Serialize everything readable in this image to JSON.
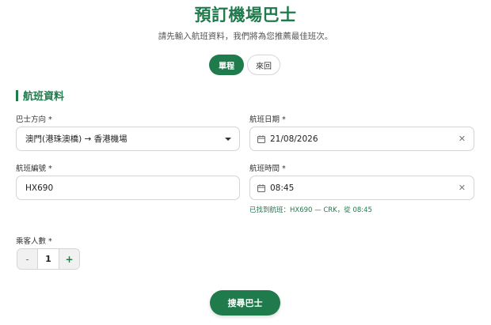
{
  "header": {
    "title": "預訂機場巴士",
    "subtitle": "請先輸入航班資料，我們將為您推薦最佳班次。"
  },
  "trip_type": {
    "options": [
      "單程",
      "來回"
    ],
    "selected": "單程"
  },
  "section": {
    "heading": "航班資料"
  },
  "form": {
    "direction": {
      "label": "巴士方向 *",
      "value": "澳門(港珠澳橋) → 香港機場"
    },
    "flight_date": {
      "label": "航班日期 *",
      "value": "21/08/2026"
    },
    "flight_number": {
      "label": "航班編號 *",
      "value": "HX690"
    },
    "flight_time": {
      "label": "航班時間 *",
      "value": "08:45",
      "hint": "已找到航班：HX690 — CRK，從 08:45"
    },
    "passengers": {
      "label": "乘客人數 *",
      "value": "1",
      "minus": "-",
      "plus": "+"
    }
  },
  "actions": {
    "search_label": "搜尋巴士"
  },
  "colors": {
    "accent": "#1f7a4c"
  },
  "icons": {
    "date": "calendar-icon",
    "time": "clock-icon",
    "clear": "close-icon",
    "dropdown": "chevron-down-icon"
  }
}
